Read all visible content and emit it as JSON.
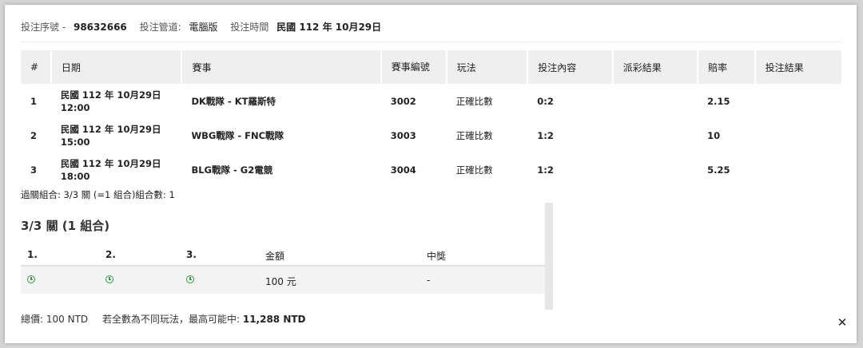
{
  "header": {
    "serial_label": "投注序號 -",
    "serial_value": "98632666",
    "channel_label": "投注管道:",
    "channel_value": "電腦版",
    "time_label": "投注時間",
    "time_value": "民國 112 年 10月29日"
  },
  "bets_table": {
    "columns": [
      "#",
      "日期",
      "賽事",
      "賽事編號",
      "玩法",
      "投注內容",
      "派彩結果",
      "賠率",
      "投注結果"
    ],
    "rows": [
      {
        "no": "1",
        "date": "民國 112 年 10月29日",
        "time": "12:00",
        "match": "DK戰隊 - KT羅斯特",
        "event_no": "3002",
        "play": "正確比數",
        "bet": "0:2",
        "payout": "",
        "odds": "2.15",
        "result": ""
      },
      {
        "no": "2",
        "date": "民國 112 年 10月29日",
        "time": "15:00",
        "match": "WBG戰隊 - FNC戰隊",
        "event_no": "3003",
        "play": "正確比數",
        "bet": "1:2",
        "payout": "",
        "odds": "10",
        "result": ""
      },
      {
        "no": "3",
        "date": "民國 112 年 10月29日",
        "time": "18:00",
        "match": "BLG戰隊 - G2電競",
        "event_no": "3004",
        "play": "正確比數",
        "bet": "1:2",
        "payout": "",
        "odds": "5.25",
        "result": ""
      }
    ]
  },
  "combo_summary": "過關組合: 3/3 關 (=1 組合)組合數: 1",
  "combo": {
    "title": "3/3 關 (1 組合)",
    "headers": [
      "1.",
      "2.",
      "3.",
      "金額",
      "中獎"
    ],
    "row": {
      "icons": [
        "clock-icon",
        "clock-icon",
        "clock-icon"
      ],
      "amount": "100 元",
      "prize": "-"
    }
  },
  "footer": {
    "total_label": "總價:",
    "total_value": "100 NTD",
    "max_label": "若全數為不同玩法，最高可能中:",
    "max_value": "11,288 NTD"
  },
  "close_icon": "close-icon"
}
